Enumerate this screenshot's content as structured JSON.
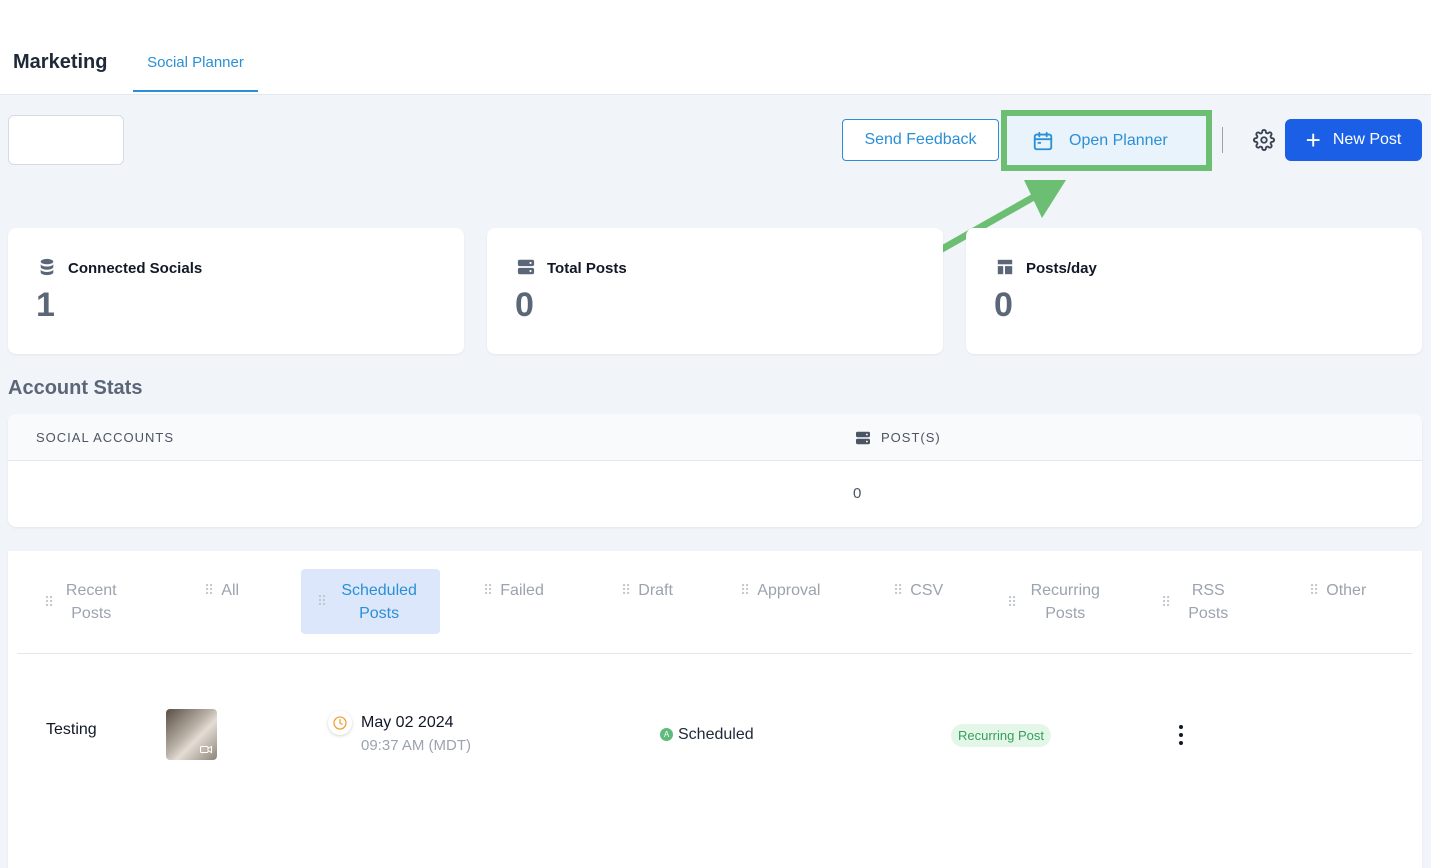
{
  "header": {
    "app_title": "Marketing",
    "tabs": [
      {
        "label": "Social Planner",
        "active": true
      }
    ]
  },
  "toolbar": {
    "send_feedback_label": "Send Feedback",
    "open_planner_label": "Open Planner",
    "new_post_label": "New Post",
    "new_post_icon": "plus-icon",
    "settings_icon": "gear-icon"
  },
  "stats": [
    {
      "label": "Connected Socials",
      "value": "1",
      "icon": "database-icon"
    },
    {
      "label": "Total Posts",
      "value": "0",
      "icon": "server-icon"
    },
    {
      "label": "Posts/day",
      "value": "0",
      "icon": "layout-icon"
    }
  ],
  "account_stats": {
    "title": "Account Stats",
    "columns": [
      "SOCIAL ACCOUNTS",
      "POST(S)"
    ],
    "rows": [
      {
        "account": "",
        "posts": "0"
      }
    ]
  },
  "post_tabs": [
    {
      "label": "Recent Posts",
      "active": false
    },
    {
      "label": "All",
      "active": false
    },
    {
      "label": "Scheduled Posts",
      "active": true
    },
    {
      "label": "Failed",
      "active": false
    },
    {
      "label": "Draft",
      "active": false
    },
    {
      "label": "Approval",
      "active": false
    },
    {
      "label": "CSV",
      "active": false
    },
    {
      "label": "Recurring Posts",
      "active": false
    },
    {
      "label": "RSS Posts",
      "active": false
    },
    {
      "label": "Other",
      "active": false
    }
  ],
  "posts": [
    {
      "name": "Testing",
      "date": "May 02 2024",
      "time": "09:37 AM (MDT)",
      "status_initial": "A",
      "status": "Scheduled",
      "badge": "Recurring Post"
    }
  ],
  "colors": {
    "accent": "#2b8fd6",
    "primary_button": "#1a5fe6",
    "highlight": "#6cbf72",
    "status_green": "#5fba7d"
  }
}
